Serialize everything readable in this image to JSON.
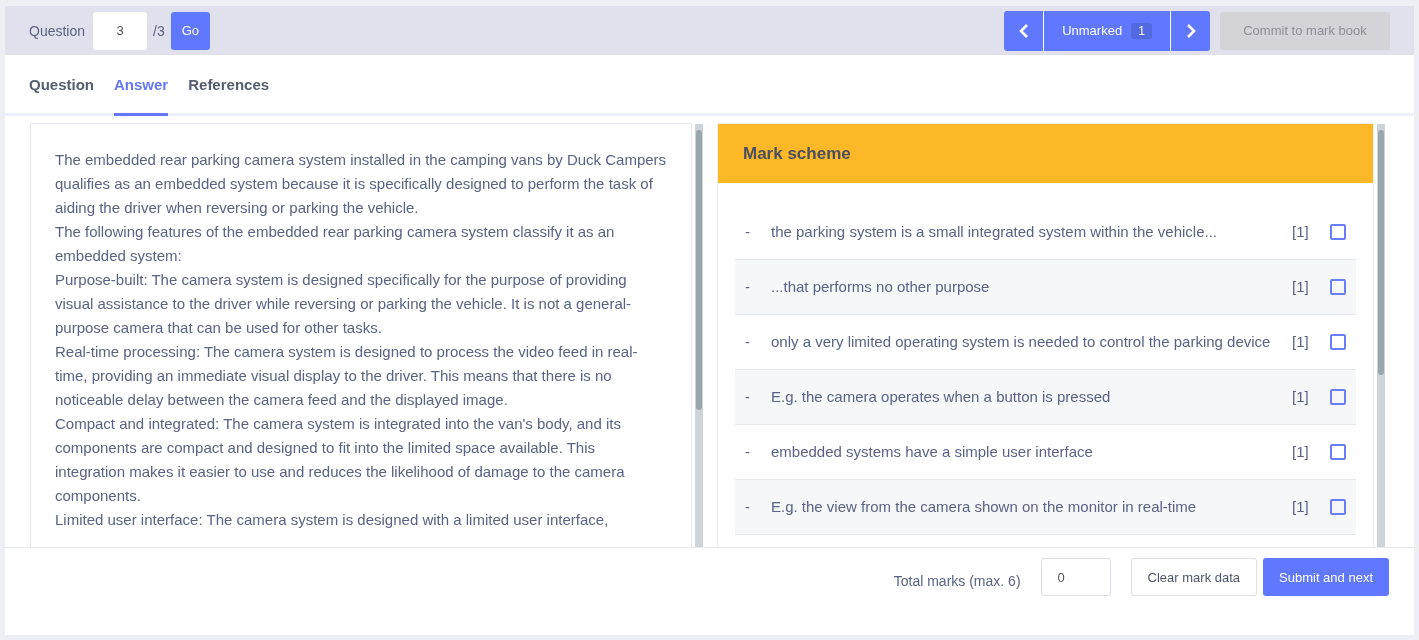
{
  "toolbar": {
    "question_label": "Question",
    "question_value": "3",
    "question_total": "/3",
    "go_button": "Go",
    "prev_disabled": false,
    "filter_label": "Unmarked",
    "filter_count": "1",
    "next_disabled": false,
    "commit_button": "Commit to mark book",
    "commit_disabled": true
  },
  "tabs": [
    {
      "label": "Question",
      "selected": false
    },
    {
      "label": "Answer",
      "selected": true
    },
    {
      "label": "References",
      "selected": false
    }
  ],
  "answer": [
    "The embedded rear parking camera system installed in the camping vans by Duck Campers qualifies as an embedded system because it is specifically designed to perform the task of aiding the driver when reversing or parking the vehicle.",
    "The following features of the embedded rear parking camera system classify it as an embedded system:",
    "Purpose-built: The camera system is designed specifically for the purpose of providing visual assistance to the driver while reversing or parking the vehicle. It is not a general-purpose camera that can be used for other tasks.",
    "Real-time processing: The camera system is designed to process the video feed in real-time, providing an immediate visual display to the driver. This means that there is no noticeable delay between the camera feed and the displayed image.",
    "Compact and integrated: The camera system is integrated into the van's body, and its components are compact and designed to fit into the limited space available. This integration makes it easier to use and reduces the likelihood of damage to the camera components.",
    "Limited user interface: The camera system is designed with a limited user interface,"
  ],
  "mark_scheme": {
    "title": "Mark scheme",
    "items": [
      {
        "bullet": "-",
        "text": "the parking system is a small integrated system within the vehicle...",
        "marks": "[1]",
        "checked": false
      },
      {
        "bullet": "-",
        "text": "...that performs no other purpose",
        "marks": "[1]",
        "checked": false
      },
      {
        "bullet": "-",
        "text": "only a very limited operating system is needed to control the parking device",
        "marks": "[1]",
        "checked": false
      },
      {
        "bullet": "-",
        "text": "E.g. the camera operates when a button is pressed",
        "marks": "[1]",
        "checked": false
      },
      {
        "bullet": "-",
        "text": "embedded systems have a simple user interface",
        "marks": "[1]",
        "checked": false
      },
      {
        "bullet": "-",
        "text": "E.g. the view from the camera shown on the monitor in real-time",
        "marks": "[1]",
        "checked": false
      }
    ]
  },
  "footer": {
    "total_label": "Total marks (max. 6)",
    "total_value": "0",
    "clear_button": "Clear mark data",
    "submit_button": "Submit and next"
  }
}
